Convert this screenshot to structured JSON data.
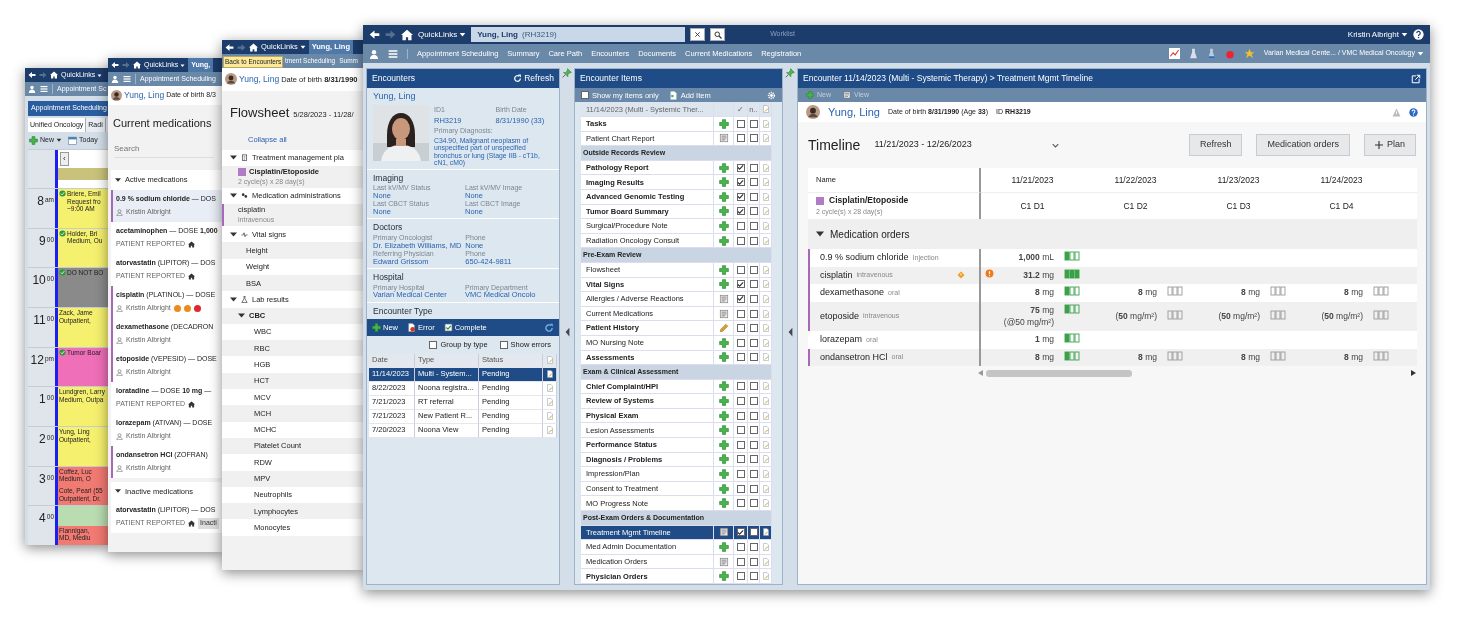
{
  "calendar_window": {
    "quicklinks": "QuickLinks",
    "menu_item": "Appointment Sc",
    "panel_title": "Appointment Scheduling",
    "tabs": [
      {
        "label": "Unified Oncology",
        "selected": true
      },
      {
        "label": "Radi",
        "selected": false
      }
    ],
    "toolbar": [
      {
        "kind": "new",
        "label": "New"
      },
      {
        "kind": "today",
        "label": "Today"
      }
    ],
    "prev_button": "‹",
    "hours": [
      {
        "appointments": [
          {
            "color": "#c9c27c"
          }
        ]
      },
      {
        "label": "8",
        "suffix": "am",
        "appointments": [
          {
            "lines": [
              "Briere, Emil",
              "Request fro",
              "~9:00 AM"
            ],
            "color": "#f5f06e",
            "confirmed": true
          }
        ]
      },
      {
        "label": "9",
        "suffix": "00",
        "appointments": [
          {
            "lines": [
              "Holder, Bri",
              "Medium, Ou"
            ],
            "color": "#f5f06e",
            "confirmed": true
          }
        ]
      },
      {
        "label": "10",
        "suffix": "00",
        "appointments": [
          {
            "lines": [
              "DO NOT BO"
            ],
            "color": "#8a8a8a",
            "confirmed": true
          }
        ]
      },
      {
        "label": "11",
        "suffix": "00",
        "appointments": [
          {
            "lines": [
              "Zack, Jame",
              "Outpatient,"
            ],
            "color": "#f5f06e",
            "confirmed": false
          }
        ]
      },
      {
        "label": "12",
        "suffix": "pm",
        "appointments": [
          {
            "lines": [
              "Tumor Boar"
            ],
            "color": "#ef6fb8",
            "confirmed": true
          }
        ]
      },
      {
        "label": "1",
        "suffix": "00",
        "appointments": [
          {
            "lines": [
              "Lundgren, Larry",
              "Medium, Outpa"
            ],
            "color": "#f5f06e",
            "confirmed": false
          }
        ]
      },
      {
        "label": "2",
        "suffix": "00",
        "appointments": [
          {
            "lines": [
              "Yung, Ling",
              "Outpatient,"
            ],
            "color": "#f5f06e",
            "confirmed": false
          }
        ]
      },
      {
        "label": "3",
        "suffix": "00",
        "appointments": [
          {
            "lines": [
              "Coffez, Luc",
              "Medium, O"
            ],
            "color": "#f17a72",
            "confirmed": false
          },
          {
            "lines": [
              "Cote, Pearl (55",
              "Outpatient, Dr."
            ],
            "color": "#f17a72",
            "confirmed": false
          }
        ]
      },
      {
        "label": "4",
        "suffix": "00",
        "appointments": [
          {
            "color": "#b9dcb0"
          },
          {
            "lines": [
              "Flannigan,",
              "MD, Mediu"
            ],
            "color": "#f17a72",
            "confirmed": false
          }
        ]
      }
    ]
  },
  "medications_window": {
    "quicklinks": "QuickLinks",
    "patient_tab": "Yung,",
    "menu_item": "Appointment Scheduling",
    "patient_name": "Yung, Ling",
    "dob": "Date of birth 8/3",
    "title": "Current medications",
    "search": {
      "placeholder": "Search"
    },
    "sections": [
      {
        "title": "Active medications",
        "expanded": true,
        "items": [
          {
            "text": "**0.9 % sodium chloride** — DOS",
            "kind": "clinician",
            "source": "Kristin Albright",
            "flagged": true,
            "selected": true
          },
          {
            "text": "**acetaminophen** — DOSE **1,000**",
            "kind": "patient",
            "source": "PATIENT REPORTED",
            "flagged": false,
            "selected": false
          },
          {
            "text": "**atorvastatin** (LIPITOR) — DOS",
            "kind": "patient",
            "source": "PATIENT REPORTED",
            "flagged": false,
            "selected": false
          },
          {
            "text": "**cisplatin** (PLATINOL) — DOSE",
            "kind": "clinician",
            "source": "Kristin Albright",
            "flagged": true,
            "selected": false,
            "alerts": [
              {
                "color": "#ee8a1c"
              },
              {
                "color": "#ee8a1c"
              },
              {
                "color": "#e0262e"
              }
            ]
          },
          {
            "text": "**dexamethasone** (DECADRON",
            "kind": "clinician",
            "source": "Kristin Albright",
            "flagged": true,
            "selected": false
          },
          {
            "text": "**etoposide** (VEPESID) — DOSE",
            "kind": "clinician",
            "source": "Kristin Albright",
            "flagged": true,
            "selected": false
          },
          {
            "text": "**loratadine** — DOSE **10 mg** —",
            "kind": "patient",
            "source": "PATIENT REPORTED",
            "flagged": false,
            "selected": false
          },
          {
            "text": "**lorazepam** (ATIVAN) — DOSE",
            "kind": "clinician",
            "source": "Kristin Albright",
            "flagged": false,
            "selected": false
          },
          {
            "text": "**ondansetron HCl** (ZOFRAN)",
            "kind": "clinician",
            "source": "Kristin Albright",
            "flagged": true,
            "selected": false
          }
        ]
      },
      {
        "title": "Inactive medications",
        "expanded": true,
        "items": [
          {
            "text": "**atorvastatin** (LIPITOR) — DOS",
            "kind": "patient",
            "source": "PATIENT REPORTED",
            "flagged": false,
            "selected": false,
            "badge": "Inacti"
          }
        ]
      }
    ]
  },
  "flowsheet_window": {
    "quicklinks": "QuickLinks",
    "patient_tab": "Yung, Ling",
    "tooltip": "Back to Encounters",
    "menu": [
      "tment Scheduling",
      "Summ"
    ],
    "patient_name": "Yung, Ling",
    "dob": "Date of birth **8/31/1990**",
    "title": "Flowsheet",
    "range": "5/28/2023 - 11/28/",
    "collapse_all": "Collapse all",
    "tree": [
      {
        "label": "Treatment management pla",
        "kind": "plan",
        "expanded": true,
        "children": [
          {
            "label": "Cisplatin/Etoposide",
            "sub": "2 cycle(s) x 28 day(s)",
            "color": "#b07cc6"
          }
        ]
      },
      {
        "label": "Medication administrations",
        "kind": "meds",
        "expanded": true,
        "children": [
          {
            "label": "cisplatin",
            "sub": "intravenous",
            "flagged": true
          }
        ]
      },
      {
        "label": "Vital signs",
        "kind": "vitals",
        "expanded": true,
        "children": [
          {
            "label": "Height"
          },
          {
            "label": "Weight"
          },
          {
            "label": "BSA"
          }
        ]
      },
      {
        "label": "Lab results",
        "kind": "labs",
        "expanded": true,
        "children": [
          {
            "label": "CBC",
            "expanded": true,
            "children": [
              {
                "label": "WBC"
              },
              {
                "label": "RBC"
              },
              {
                "label": "HGB"
              },
              {
                "label": "HCT"
              },
              {
                "label": "MCV"
              },
              {
                "label": "MCH"
              },
              {
                "label": "MCHC"
              },
              {
                "label": "Platelet Count"
              },
              {
                "label": "RDW"
              },
              {
                "label": "MPV"
              },
              {
                "label": "Neutrophils"
              },
              {
                "label": "Lymphocytes"
              },
              {
                "label": "Monocytes"
              }
            ]
          }
        ]
      }
    ]
  },
  "main_window": {
    "quicklinks": "QuickLinks",
    "patient_tab": "Yung, Ling",
    "patient_id": "(RH3219)",
    "worklist": "Worklist",
    "user": "Kristin Albright",
    "menu": [
      "Appointment Scheduling",
      "Summary",
      "Care Path",
      "Encounters",
      "Documents",
      "Current Medications",
      "Registration"
    ],
    "location": "Varian Medical Cente... / VMC Medical Oncology",
    "encounters_panel": {
      "title": "Encounters",
      "refresh": "Refresh",
      "patient": {
        "name": "Yung, Ling",
        "fields": [
          {
            "label": "ID1",
            "value": "RH3219"
          },
          {
            "label": "Birth Date",
            "value": "8/31/1990  (33)"
          }
        ],
        "diagnosis_label": "Primary Diagnosis:",
        "diagnosis": "C34.90, Malignant neoplasm of unspecified part of unspecified bronchus or lung (Stage IIB - cT1b, cN1, cM0)"
      },
      "sections": [
        {
          "title": "Imaging",
          "fields": [
            {
              "label": "Last kV/MV Status",
              "value": "None"
            },
            {
              "label": "Last kV/MV Image",
              "value": "None"
            },
            {
              "label": "Last CBCT Status",
              "value": "None"
            },
            {
              "label": "Last CBCT Image",
              "value": "None"
            }
          ]
        },
        {
          "title": "Doctors",
          "fields": [
            {
              "label": "Primary Oncologist",
              "value": "Dr. Elizabeth Williams, MD"
            },
            {
              "label": "Phone",
              "value": "None"
            },
            {
              "label": "Referring Physician",
              "value": "Edward Grissom"
            },
            {
              "label": "Phone",
              "value": "650-424-9811"
            }
          ]
        },
        {
          "title": "Hospital",
          "fields": [
            {
              "label": "Primary Hospital",
              "value": "Varian Medical Center"
            },
            {
              "label": "Primary Department",
              "value": "VMC Medical Oncolo"
            }
          ]
        }
      ],
      "type_heading": "Encounter Type",
      "toolbar": [
        {
          "kind": "new",
          "label": "New"
        },
        {
          "kind": "error",
          "label": "Error"
        },
        {
          "kind": "complete",
          "label": "Complete"
        }
      ],
      "options": [
        {
          "label": "Group by type",
          "checked": false
        },
        {
          "label": "Show errors",
          "checked": false
        }
      ],
      "columns": [
        "Date",
        "Type",
        "Status"
      ],
      "rows": [
        {
          "date": "11/14/2023",
          "type": "Multi - System...",
          "status": "Pending",
          "selected": true
        },
        {
          "date": "8/22/2023",
          "type": "Noona registra...",
          "status": "Pending",
          "selected": false
        },
        {
          "date": "7/21/2023",
          "type": "RT referral",
          "status": "Pending",
          "selected": false
        },
        {
          "date": "7/21/2023",
          "type": "New Patient R...",
          "status": "Pending",
          "selected": false
        },
        {
          "date": "7/20/2023",
          "type": "Noona View",
          "status": "Pending",
          "selected": false
        }
      ]
    },
    "items_panel": {
      "title": "Encounter Items",
      "show_mine": {
        "label": "Show my items only",
        "checked": false
      },
      "add_item": "Add Item",
      "header": {
        "encounter": "11/14/2023 (Multi - Systemic Ther...",
        "col_done": "✓",
        "col_2": "n.."
      },
      "groups": [
        {
          "items": [
            {
              "name": "Tasks",
              "bold": true,
              "kind": "add",
              "done": false,
              "noted": false,
              "selected": false
            },
            {
              "name": "Patient Chart Report",
              "bold": false,
              "kind": "form",
              "done": false,
              "noted": false,
              "selected": false
            }
          ]
        },
        {
          "title": "Outside Records Review",
          "items": [
            {
              "name": "Pathology Report",
              "bold": true,
              "kind": "add",
              "done": true,
              "noted": false,
              "selected": false
            },
            {
              "name": "Imaging Results",
              "bold": true,
              "kind": "add",
              "done": true,
              "noted": false,
              "selected": false
            },
            {
              "name": "Advanced Genomic Testing",
              "bold": true,
              "kind": "add",
              "done": true,
              "noted": false,
              "selected": false
            },
            {
              "name": "Tumor Board Summary",
              "bold": true,
              "kind": "add",
              "done": true,
              "noted": false,
              "selected": false
            },
            {
              "name": "Surgical/Procedure Note",
              "bold": false,
              "kind": "add",
              "done": false,
              "noted": false,
              "selected": false
            },
            {
              "name": "Radiation Oncology Consult",
              "bold": false,
              "kind": "add",
              "done": false,
              "noted": false,
              "selected": false
            }
          ]
        },
        {
          "title": "Pre-Exam Review",
          "items": [
            {
              "name": "Flowsheet",
              "bold": false,
              "kind": "add",
              "done": false,
              "noted": false,
              "selected": false
            },
            {
              "name": "Vital Signs",
              "bold": true,
              "kind": "add",
              "done": true,
              "noted": false,
              "selected": false
            },
            {
              "name": "Allergies / Adverse Reactions",
              "bold": false,
              "kind": "form",
              "done": true,
              "noted": false,
              "selected": false
            },
            {
              "name": "Current Medications",
              "bold": false,
              "kind": "form",
              "done": false,
              "noted": false,
              "selected": false
            },
            {
              "name": "Patient History",
              "bold": true,
              "kind": "edit",
              "done": false,
              "noted": false,
              "selected": false
            },
            {
              "name": "MO Nursing Note",
              "bold": false,
              "kind": "add",
              "done": false,
              "noted": false,
              "selected": false
            },
            {
              "name": "Assessments",
              "bold": true,
              "kind": "add",
              "done": false,
              "noted": false,
              "selected": false
            }
          ]
        },
        {
          "title": "Exam & Clinical Assessment",
          "items": [
            {
              "name": "Chief Complaint/HPI",
              "bold": true,
              "kind": "add",
              "done": false,
              "noted": false,
              "selected": false
            },
            {
              "name": "Review of Systems",
              "bold": true,
              "kind": "add",
              "done": false,
              "noted": false,
              "selected": false
            },
            {
              "name": "Physical Exam",
              "bold": true,
              "kind": "add",
              "done": false,
              "noted": false,
              "selected": false
            },
            {
              "name": "Lesion Assessments",
              "bold": false,
              "kind": "add",
              "done": false,
              "noted": false,
              "selected": false
            },
            {
              "name": "Performance Status",
              "bold": true,
              "kind": "add",
              "done": false,
              "noted": false,
              "selected": false
            },
            {
              "name": "Diagnosis / Problems",
              "bold": true,
              "kind": "add",
              "done": false,
              "noted": false,
              "selected": false
            },
            {
              "name": "Impression/Plan",
              "bold": false,
              "kind": "add",
              "done": false,
              "noted": false,
              "selected": false
            },
            {
              "name": "Consent to Treatment",
              "bold": false,
              "kind": "add",
              "done": false,
              "noted": false,
              "selected": false
            },
            {
              "name": "MO Progress Note",
              "bold": false,
              "kind": "add",
              "done": false,
              "noted": false,
              "selected": false
            }
          ]
        },
        {
          "title": "Post-Exam Orders & Documentation",
          "items": [
            {
              "name": "Treatment Mgmt Timeline",
              "bold": false,
              "kind": "form",
              "done": true,
              "noted": false,
              "selected": true
            },
            {
              "name": "Med Admin Documentation",
              "bold": false,
              "kind": "add",
              "done": false,
              "noted": false,
              "selected": false
            },
            {
              "name": "Medication Orders",
              "bold": false,
              "kind": "form",
              "done": false,
              "noted": false,
              "selected": false
            },
            {
              "name": "Physician Orders",
              "bold": true,
              "kind": "add",
              "done": false,
              "noted": false,
              "selected": false
            }
          ]
        }
      ]
    },
    "timeline_panel": {
      "title": "Encounter 11/14/2023 (Multi - Systemic Therapy) > Treatment Mgmt Timeline",
      "toolbar": [
        {
          "kind": "new",
          "label": "New",
          "disabled": true
        },
        {
          "kind": "view",
          "label": "View",
          "disabled": true
        }
      ],
      "patient": {
        "name": "Yung, Ling",
        "dob": "Date of birth **8/31/1990** (Age **33**)",
        "id": "ID **RH3219**"
      },
      "heading": "Timeline",
      "range": "11/21/2023 - 12/26/2023",
      "buttons": [
        {
          "kind": "refresh",
          "label": "Refresh"
        },
        {
          "kind": "orders",
          "label": "Medication orders"
        },
        {
          "kind": "plan",
          "label": "Plan"
        }
      ],
      "columns": [
        "Name",
        "11/21/2023",
        "11/22/2023",
        "11/23/2023",
        "11/24/2023"
      ],
      "plan": {
        "name": "Cisplatin/Etoposide",
        "sub": "2 cycle(s) x 28 day(s)",
        "color": "#b07cc6",
        "days": [
          "C1 D1",
          "C1 D2",
          "C1 D3",
          "C1 D4"
        ]
      },
      "section": {
        "title": "Medication orders",
        "expanded": true
      },
      "orders": [
        {
          "name": "0.9 % sodium chloride",
          "route": "Injection",
          "flagged": true,
          "warning": false,
          "cells": [
            {
              "text": "**1,000** mL",
              "kind": "partial"
            },
            null,
            null,
            null
          ]
        },
        {
          "name": "cisplatin",
          "route": "intravenous",
          "flagged": true,
          "warning": true,
          "cells": [
            {
              "text": "**31.2** mg",
              "kind": "complete",
              "alert": true
            },
            null,
            null,
            null
          ]
        },
        {
          "name": "dexamethasone",
          "route": "oral",
          "flagged": true,
          "warning": false,
          "cells": [
            {
              "text": "**8** mg",
              "kind": "partial"
            },
            {
              "text": "**8** mg",
              "kind": "planned"
            },
            {
              "text": "**8** mg",
              "kind": "planned"
            },
            {
              "text": "**8** mg",
              "kind": "planned"
            }
          ]
        },
        {
          "name": "etoposide",
          "route": "intravenous",
          "flagged": true,
          "warning": false,
          "cells": [
            {
              "text": "**75** mg",
              "note": "(@50 mg/m²)",
              "kind": "partial"
            },
            {
              "text": "(**50** mg/m²)",
              "kind": "planned"
            },
            {
              "text": "(**50** mg/m²)",
              "kind": "planned"
            },
            {
              "text": "(**50** mg/m²)",
              "kind": "planned"
            }
          ]
        },
        {
          "name": "lorazepam",
          "route": "oral",
          "flagged": false,
          "warning": false,
          "cells": [
            {
              "text": "**1** mg",
              "kind": "partial"
            },
            null,
            null,
            null
          ]
        },
        {
          "name": "ondansetron HCl",
          "route": "oral",
          "flagged": true,
          "warning": false,
          "cells": [
            {
              "text": "**8** mg",
              "kind": "partial"
            },
            {
              "text": "**8** mg",
              "kind": "planned"
            },
            {
              "text": "**8** mg",
              "kind": "planned"
            },
            {
              "text": "**8** mg",
              "kind": "planned"
            }
          ]
        }
      ]
    }
  }
}
